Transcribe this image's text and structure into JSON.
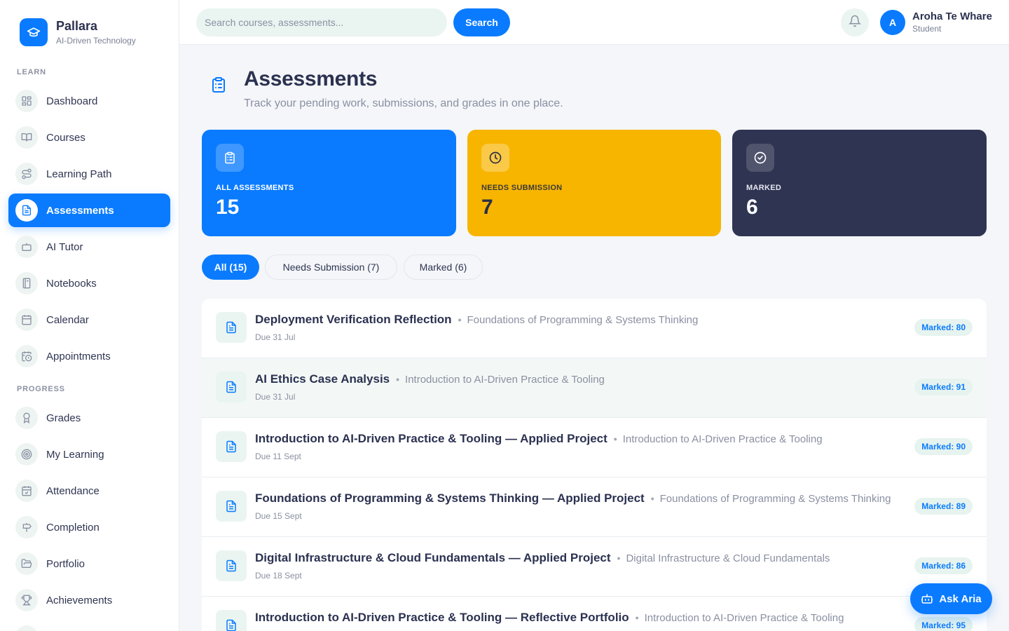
{
  "brand": {
    "name": "Pallara",
    "subtitle": "AI-Driven Technology"
  },
  "sidebar": {
    "sections": [
      {
        "label": "LEARN"
      },
      {
        "label": "PROGRESS"
      }
    ],
    "items": [
      {
        "label": "Dashboard",
        "icon": "dashboard-icon"
      },
      {
        "label": "Courses",
        "icon": "book-open-icon"
      },
      {
        "label": "Learning Path",
        "icon": "route-icon"
      },
      {
        "label": "Assessments",
        "icon": "file-text-icon",
        "active": true
      },
      {
        "label": "AI Tutor",
        "icon": "bot-icon"
      },
      {
        "label": "Notebooks",
        "icon": "notebook-icon"
      },
      {
        "label": "Calendar",
        "icon": "calendar-icon"
      },
      {
        "label": "Appointments",
        "icon": "calendar-clock-icon"
      },
      {
        "label": "Grades",
        "icon": "award-icon"
      },
      {
        "label": "My Learning",
        "icon": "target-icon"
      },
      {
        "label": "Attendance",
        "icon": "calendar-check-icon"
      },
      {
        "label": "Completion",
        "icon": "signpost-icon"
      },
      {
        "label": "Portfolio",
        "icon": "folder-open-icon"
      },
      {
        "label": "Achievements",
        "icon": "trophy-icon"
      }
    ]
  },
  "topbar": {
    "search_placeholder": "Search courses, assessments...",
    "search_button": "Search",
    "user": {
      "initial": "A",
      "name": "Aroha Te Whare",
      "role": "Student"
    }
  },
  "header": {
    "title": "Assessments",
    "subtitle": "Track your pending work, submissions, and grades in one place."
  },
  "stats": [
    {
      "label": "ALL ASSESSMENTS",
      "value": "15",
      "icon": "clipboard-list-icon",
      "bg": "#0a7bff",
      "fg": "#ffffff"
    },
    {
      "label": "NEEDS SUBMISSION",
      "value": "7",
      "icon": "clock-icon",
      "bg": "#f7b500",
      "fg": "#2b2f44"
    },
    {
      "label": "MARKED",
      "value": "6",
      "icon": "check-circle-icon",
      "bg": "#2f3452",
      "fg": "#ffffff"
    }
  ],
  "filters": [
    {
      "label": "All (15)",
      "active": true
    },
    {
      "label": "Needs Submission (7)",
      "active": false
    },
    {
      "label": "Marked (6)",
      "active": false
    }
  ],
  "assessments": [
    {
      "title": "Deployment Verification Reflection",
      "course": "Foundations of Programming & Systems Thinking",
      "due": "Due 31 Jul",
      "status": "Marked: 80"
    },
    {
      "title": "AI Ethics Case Analysis",
      "course": "Introduction to AI-Driven Practice & Tooling",
      "due": "Due 31 Jul",
      "status": "Marked: 91"
    },
    {
      "title": "Introduction to AI-Driven Practice & Tooling — Applied Project",
      "course": "Introduction to AI-Driven Practice & Tooling",
      "due": "Due 11 Sept",
      "status": "Marked: 90"
    },
    {
      "title": "Foundations of Programming & Systems Thinking — Applied Project",
      "course": "Foundations of Programming & Systems Thinking",
      "due": "Due 15 Sept",
      "status": "Marked: 89"
    },
    {
      "title": "Digital Infrastructure & Cloud Fundamentals — Applied Project",
      "course": "Digital Infrastructure & Cloud Fundamentals",
      "due": "Due 18 Sept",
      "status": "Marked: 86"
    },
    {
      "title": "Introduction to AI-Driven Practice & Tooling — Reflective Portfolio",
      "course": "Introduction to AI-Driven Practice & Tooling",
      "due": "",
      "status": "Marked: 95"
    }
  ],
  "assistant": {
    "label": "Ask Aria",
    "icon": "bot-icon"
  },
  "colors": {
    "accent": "#0a7bff",
    "warning": "#f7b500",
    "dark": "#2f3452",
    "mint": "#eaf5f1"
  }
}
